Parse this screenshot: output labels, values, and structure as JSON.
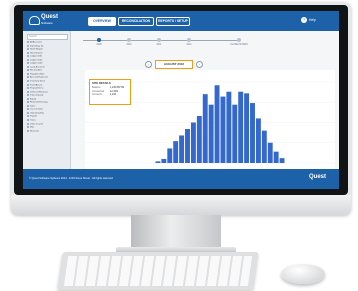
{
  "app": {
    "logo_text": "Quest",
    "logo_sub": "Software",
    "logo_icon": "cloud-icon"
  },
  "nav": {
    "items": [
      {
        "label": "OVERVIEW",
        "active": true
      },
      {
        "label": "RECONCILIATION",
        "active": false
      },
      {
        "label": "REPORTS / SETUP",
        "active": false
      }
    ],
    "help_label": "Help"
  },
  "sidebar": {
    "search_placeholder": "Search",
    "items": [
      "All Accounts",
      "Subsidiary Inc",
      "North Region",
      "West Branch",
      "Ledger 1001",
      "Ledger 1002",
      "Ledger 1003",
      "Cash Accounts",
      "Receivables",
      "Payables Main",
      "Accrued Expenses",
      "Inventory Stock",
      "Fixed Assets",
      "Prepaid Items",
      "Deferred Revenue",
      "Intercompany",
      "Equity",
      "Retained Earnings",
      "Sales",
      "Cost of Sales",
      "Operating Exp",
      "Payroll",
      "Taxes",
      "Other Income",
      "Misc",
      "Reserves"
    ]
  },
  "timeline": {
    "labels": [
      "2009",
      "2010",
      "2011",
      "2012",
      "CLOSE FILTERS"
    ],
    "active_index": 0
  },
  "controls": {
    "prev_icon": "chevron-left-icon",
    "next_icon": "chevron-right-icon",
    "month_label": "AUGUST 2012"
  },
  "details": {
    "title": "SITE DETAILS",
    "rows": [
      {
        "key": "Balance",
        "value": "1,234,567.89"
      },
      {
        "key": "Unmatched",
        "value": "12.34%"
      },
      {
        "key": "Accounts",
        "value": "1,234"
      }
    ]
  },
  "chart_data": {
    "type": "bar",
    "values": [
      2,
      5,
      18,
      27,
      34,
      42,
      50,
      58,
      85,
      72,
      96,
      82,
      88,
      72,
      88,
      86,
      74,
      55,
      40,
      25,
      14,
      6
    ],
    "ylim": [
      0,
      100
    ],
    "bar_color": "#3468cc",
    "grid": true
  },
  "footer": {
    "text": "© Quest Software Systems 2014 · 1234 Some Street · All rights reserved",
    "logo_text": "Quest"
  },
  "colors": {
    "primary": "#1d62a8",
    "accent": "#f39c12"
  }
}
